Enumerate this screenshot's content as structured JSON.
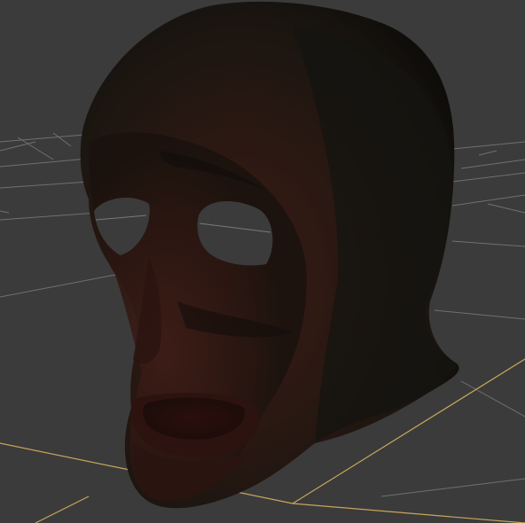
{
  "viewport": {
    "background_color": "#3b3b3b",
    "grid_line_color": "#7a7a7a",
    "grid_axis_color": "#c8a65a"
  },
  "model": {
    "description_icon": "mask-model-icon",
    "base_color": "#1d150f",
    "highlight_color": "#3a1b16",
    "shadow_color": "#0f0d0a",
    "hole_color": "#3b3b3b"
  }
}
